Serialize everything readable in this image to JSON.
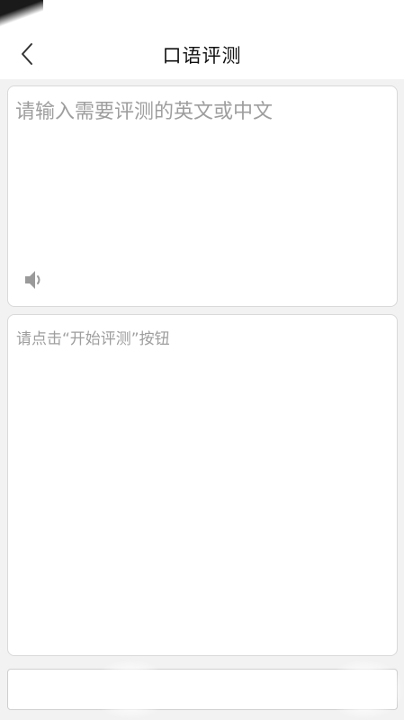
{
  "header": {
    "title": "口语评测",
    "back_icon": "chevron-left-icon"
  },
  "input": {
    "placeholder": "请输入需要评测的英文或中文",
    "value": "",
    "speaker_icon": "speaker-icon"
  },
  "result": {
    "hint": "请点击“开始评测”按钮"
  },
  "colors": {
    "background": "#f2f2f2",
    "surface": "#ffffff",
    "border": "#d9d9d9",
    "placeholder": "#9e9e9e",
    "icon": "#9a9a9a"
  }
}
